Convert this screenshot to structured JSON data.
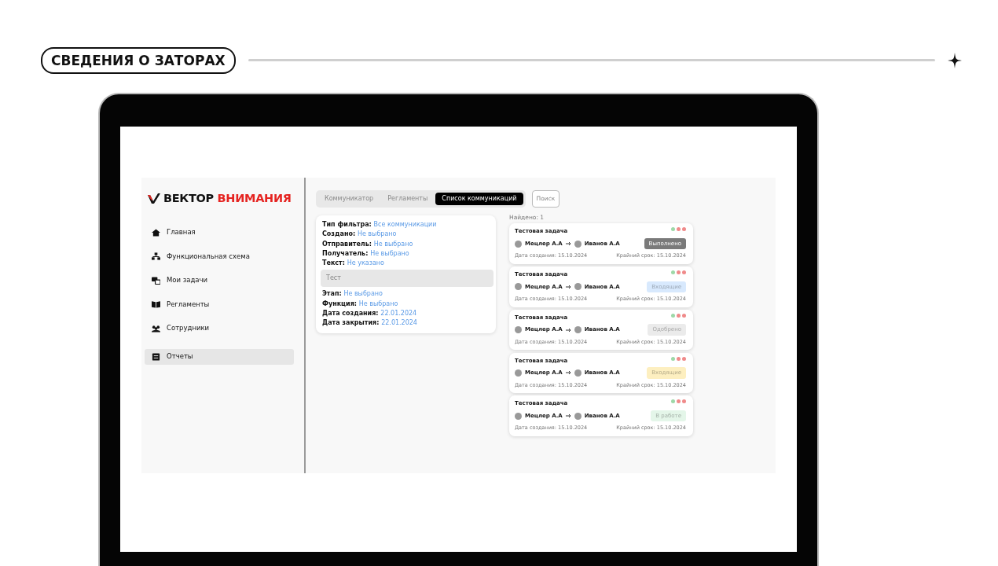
{
  "header": {
    "title": "СВЕДЕНИЯ О ЗАТОРАХ"
  },
  "logo": {
    "word1": "ВЕКТОР",
    "word2": "ВНИМАНИЯ"
  },
  "sidebar": {
    "items": [
      {
        "label": "Главная",
        "selected": false
      },
      {
        "label": "Функциональная схема",
        "selected": false
      },
      {
        "label": "Мои задачи",
        "selected": false
      },
      {
        "label": "Регламенты",
        "selected": false
      },
      {
        "label": "Сотрудники",
        "selected": false
      },
      {
        "label": "Отчеты",
        "selected": true
      }
    ]
  },
  "tabs": [
    {
      "label": "Коммуникатор",
      "selected": false
    },
    {
      "label": "Регламенты",
      "selected": false
    },
    {
      "label": "Список коммуникаций",
      "selected": true
    }
  ],
  "search_button": "Поиск",
  "filters": {
    "rows": [
      {
        "kind": "pair",
        "label": "Тип фильтра:",
        "value": "Все коммуникации"
      },
      {
        "kind": "pair",
        "label": "Создано:",
        "value": "Не выбрано"
      },
      {
        "kind": "pair",
        "label": "Отправитель:",
        "value": "Не выбрано"
      },
      {
        "kind": "pair",
        "label": "Получатель:",
        "value": "Не выбрано"
      },
      {
        "kind": "pair",
        "label": "Текст:",
        "value": "Не указано"
      },
      {
        "kind": "field",
        "placeholder": "Тест"
      },
      {
        "kind": "pair",
        "label": "Этап:",
        "value": "Не выбрано"
      },
      {
        "kind": "pair",
        "label": "Функция:",
        "value": "Не выбрано"
      },
      {
        "kind": "pair",
        "label": "Дата создания:",
        "value": "22.01.2024"
      },
      {
        "kind": "pair",
        "label": "Дата закрытия:",
        "value": "22.01.2024"
      }
    ]
  },
  "results": {
    "count": "Найдено: 1",
    "items": [
      {
        "title": "Тестовая задача",
        "from": "Мецлер А.А",
        "to": "Иванов А.А",
        "created": "Дата создания: 15.10.2024",
        "deadline": "Крайний срок: 15.10.2024",
        "status": "Выполнено",
        "color": "#7a7a7a"
      },
      {
        "title": "Тестовая задача",
        "from": "Мецлер А.А",
        "to": "Иванов А.А",
        "created": "Дата создания: 15.10.2024",
        "deadline": "Крайний срок: 15.10.2024",
        "status": "Входящие",
        "color": "#d8e9fd"
      },
      {
        "title": "Тестовая задача",
        "from": "Мецлер А.А",
        "to": "Иванов А.А",
        "created": "Дата создания: 15.10.2024",
        "deadline": "Крайний срок: 15.10.2024",
        "status": "Одобрено",
        "color": "#ebebeb"
      },
      {
        "title": "Тестовая задача",
        "from": "Мецлер А.А",
        "to": "Иванов А.А",
        "created": "Дата создания: 15.10.2024",
        "deadline": "Крайний срок: 15.10.2024",
        "status": "Входящие",
        "color": "#fdefc0"
      },
      {
        "title": "Тестовая задача",
        "from": "Мецлер А.А",
        "to": "Иванов А.А",
        "created": "Дата создания: 15.10.2024",
        "deadline": "Крайний срок: 15.10.2024",
        "status": "В работе",
        "color": "#e4f6e9"
      }
    ]
  }
}
